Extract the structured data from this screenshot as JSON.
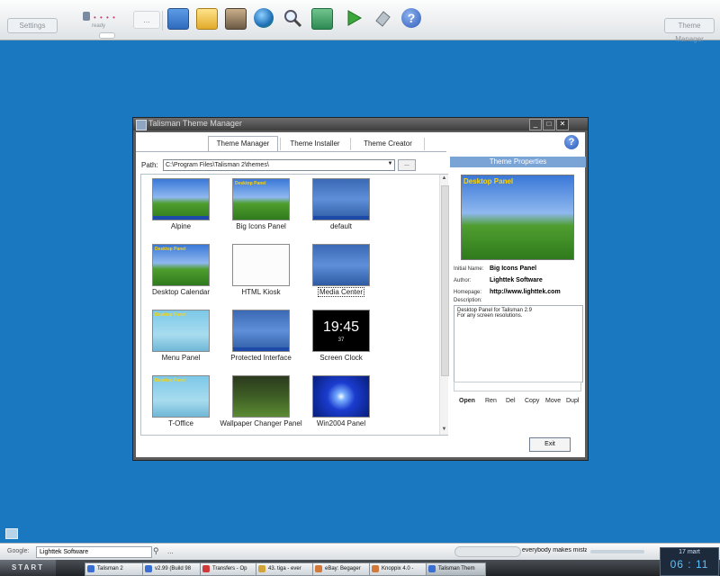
{
  "topbar": {
    "settings_label": "Settings",
    "theme_manager_label": "Theme Manager",
    "dots_label": "...",
    "mini_status": "ready"
  },
  "window": {
    "title": "Talisman Theme Manager",
    "tabs": [
      "Theme Manager",
      "Theme Installer",
      "Theme Creator"
    ],
    "help_label": "?",
    "path_label": "Path:",
    "path_value": "C:\\Program Files\\Talisman 2\\themes\\",
    "browse_label": "...",
    "themes": [
      {
        "label": "Alpine"
      },
      {
        "label": "Big Icons Panel"
      },
      {
        "label": "default"
      },
      {
        "label": "Desktop Calendar"
      },
      {
        "label": "HTML Kiosk"
      },
      {
        "label": "Media Center"
      },
      {
        "label": "Menu Panel"
      },
      {
        "label": "Protected Interface"
      },
      {
        "label": "Screen Clock"
      },
      {
        "label": "T-Office"
      },
      {
        "label": "Wallpaper Changer Panel"
      },
      {
        "label": "Win2004 Panel"
      }
    ],
    "clock_thumb": {
      "time": "19:45",
      "sub": "37"
    },
    "thumb_label": "Desktop Panel",
    "properties": {
      "header": "Theme Properties",
      "preview_label": "Desktop Panel",
      "initial_name_label": "Initial Name:",
      "initial_name": "Big Icons Panel",
      "author_label": "Author:",
      "author": "Lighttek Software",
      "homepage_label": "Homepage:",
      "homepage": "http://www.lighttek.com",
      "description_label": "Description:",
      "description_line1": "Desktop Panel for Talisman 2.9",
      "description_line2": "For any screen resolutions.",
      "actions": [
        "Open",
        "Ren",
        "Del",
        "Copy",
        "Move",
        "Dupl"
      ]
    },
    "exit_label": "Exit"
  },
  "google_bar": {
    "label": "Google:",
    "value": "Lighttek Software",
    "more": "...",
    "ticker": "everybody makes mistake"
  },
  "taskbar": {
    "start_label": "START",
    "buttons": [
      {
        "label": "Talisman 2",
        "color": "#3a6fd1"
      },
      {
        "label": "v2.99 (Build 98",
        "color": "#3a6fd1"
      },
      {
        "label": "Transfers - Op",
        "color": "#d13a3a"
      },
      {
        "label": "43. tiga - ever",
        "color": "#d1a53a"
      },
      {
        "label": "eBay: Begager",
        "color": "#d1793a"
      },
      {
        "label": "Knoppix 4.0 -",
        "color": "#d1793a"
      },
      {
        "label": "Talisman Them",
        "color": "#3a6fd1"
      }
    ],
    "date": "17 mart",
    "time": "06 : 11"
  }
}
